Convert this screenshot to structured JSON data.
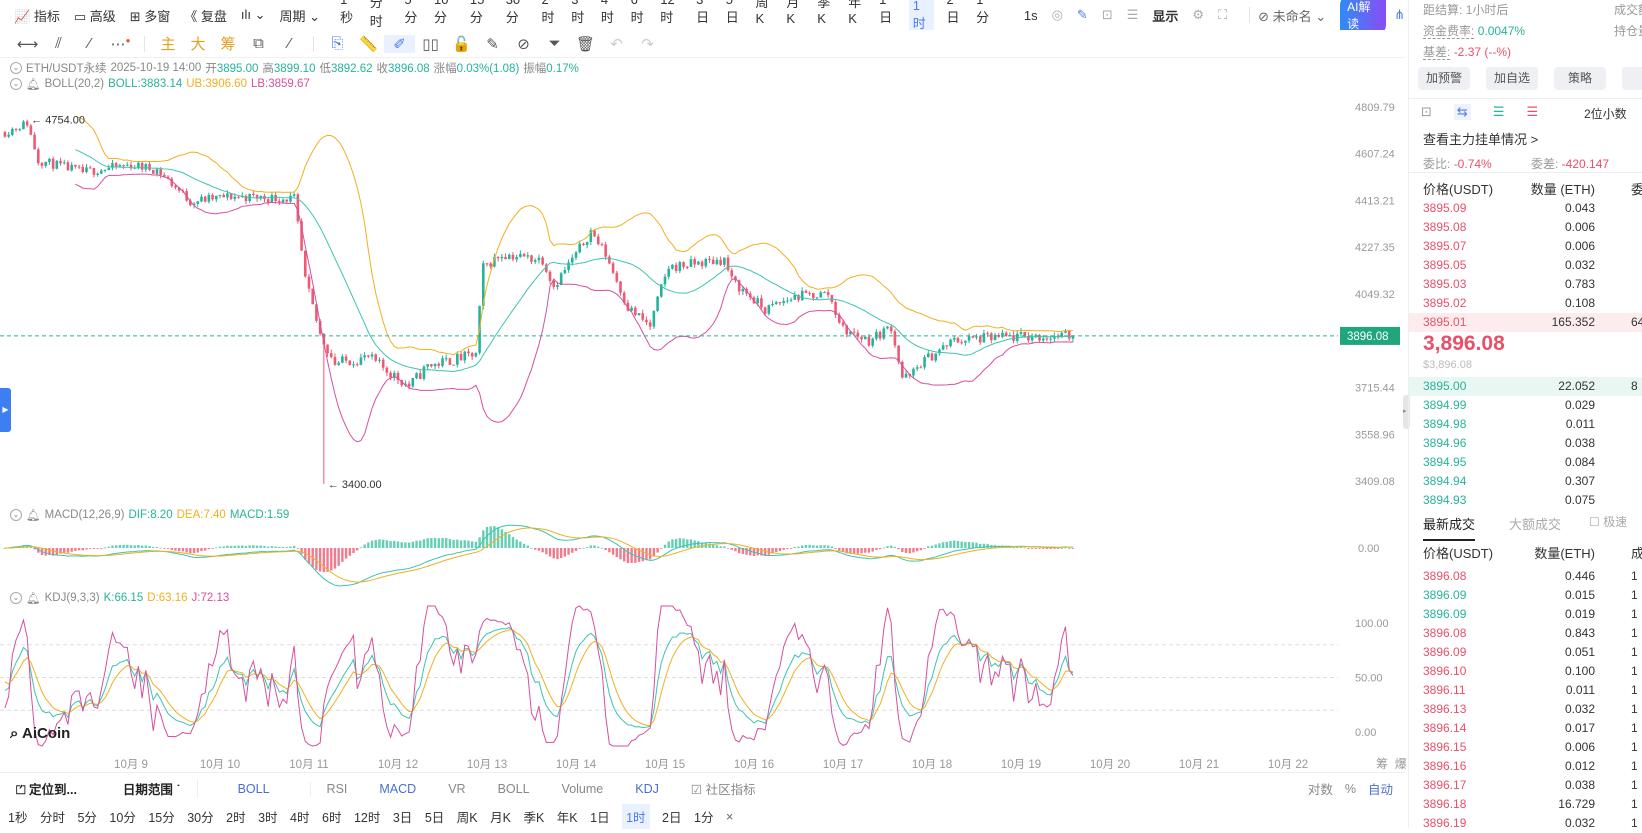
{
  "toolbar": {
    "items": [
      "指标",
      "高级",
      "多窗",
      "复盘",
      "周期"
    ],
    "periods": [
      "1秒",
      "分时",
      "5分",
      "10分",
      "15分",
      "30分",
      "2时",
      "3时",
      "4时",
      "6时",
      "12时",
      "3日",
      "5日",
      "周K",
      "月K",
      "季K",
      "年K",
      "1日",
      "1时",
      "2日",
      "1分"
    ],
    "active_period": "1时",
    "realtime": "1s",
    "display": "显示",
    "layout_name": "未命名",
    "ai_button": "AI解读"
  },
  "drawing_tools": {
    "labels": [
      "主",
      "大",
      "筹"
    ]
  },
  "legend": {
    "symbol": "ETH/USDT永续",
    "time": "2025-10-19 14:00",
    "open_label": "开",
    "open": "3895.00",
    "high_label": "高",
    "high": "3899.10",
    "low_label": "低",
    "low": "3892.62",
    "close_label": "收",
    "close": "3896.08",
    "change_label": "涨幅",
    "change": "0.03%(1.08)",
    "amp_label": "振幅",
    "amp": "0.17%"
  },
  "boll": {
    "name": "BOLL(20,2)",
    "mid": "BOLL:3883.14",
    "ub": "UB:3906.60",
    "lb": "LB:3859.67"
  },
  "macd": {
    "name": "MACD(12,26,9)",
    "dif": "DIF:8.20",
    "dea": "DEA:7.40",
    "macd": "MACD:1.59",
    "zero": "0.00"
  },
  "kdj": {
    "name": "KDJ(9,3,3)",
    "k": "K:66.15",
    "d": "D:63.16",
    "j": "J:72.13",
    "ticks": [
      "100.00",
      "50.00",
      "0.00"
    ]
  },
  "chart_data": {
    "type": "candlestick",
    "interval": "1时",
    "y_scale": "log",
    "colors": {
      "up": "#26b39b",
      "down": "#ee5a72",
      "boll_mid": "#3cc4b0",
      "boll_ub": "#f0b020",
      "boll_lb": "#d64fa0"
    },
    "y_ticks": [
      "4809.79",
      "4607.24",
      "4413.21",
      "4227.35",
      "4049.32",
      "3715.44",
      "3558.96",
      "3409.08"
    ],
    "x_ticks": [
      "10月 9",
      "10月 10",
      "10月 11",
      "10月 12",
      "10月 13",
      "10月 14",
      "10月 15",
      "10月 16",
      "10月 17",
      "10月 18",
      "10月 19",
      "10月 20",
      "10月 21",
      "10月 22"
    ],
    "last_price": "3896.08",
    "annotations": {
      "high": "4754.00",
      "low": "3400.00"
    },
    "extremes": [
      {
        "time": "2025-10-07 20:00",
        "high": 4754
      },
      {
        "time": "2025-10-11 04:00",
        "low": 3400
      }
    ],
    "close_path": [
      [
        "2025-10-07 14:00",
        4700
      ],
      [
        "2025-10-07 20:00",
        4740
      ],
      [
        "2025-10-07 23:00",
        4580
      ],
      [
        "2025-10-08 11:00",
        4530
      ],
      [
        "2025-10-09 00:00",
        4560
      ],
      [
        "2025-10-09 07:00",
        4540
      ],
      [
        "2025-10-09 16:00",
        4410
      ],
      [
        "2025-10-10 03:00",
        4430
      ],
      [
        "2025-10-10 20:00",
        4420
      ],
      [
        "2025-10-10 23:00",
        4100
      ],
      [
        "2025-10-11 03:00",
        3900
      ],
      [
        "2025-10-11 07:00",
        3800
      ],
      [
        "2025-10-11 16:00",
        3820
      ],
      [
        "2025-10-12 03:00",
        3720
      ],
      [
        "2025-10-12 08:00",
        3790
      ],
      [
        "2025-10-12 21:00",
        3830
      ],
      [
        "2025-10-12 23:00",
        4150
      ],
      [
        "2025-10-13 04:00",
        4200
      ],
      [
        "2025-10-13 15:00",
        4180
      ],
      [
        "2025-10-13 18:00",
        4080
      ],
      [
        "2025-10-14 00:00",
        4200
      ],
      [
        "2025-10-14 04:00",
        4290
      ],
      [
        "2025-10-14 08:00",
        4200
      ],
      [
        "2025-10-14 14:00",
        4000
      ],
      [
        "2025-10-14 20:00",
        3930
      ],
      [
        "2025-10-14 23:00",
        4070
      ],
      [
        "2025-10-15 01:00",
        4150
      ],
      [
        "2025-10-15 16:00",
        4180
      ],
      [
        "2025-10-15 18:00",
        4100
      ],
      [
        "2025-10-16 03:00",
        3990
      ],
      [
        "2025-10-16 11:00",
        4040
      ],
      [
        "2025-10-16 20:00",
        4050
      ],
      [
        "2025-10-17 00:00",
        3920
      ],
      [
        "2025-10-17 07:00",
        3880
      ],
      [
        "2025-10-17 13:00",
        3930
      ],
      [
        "2025-10-17 16:00",
        3750
      ],
      [
        "2025-10-17 18:00",
        3750
      ],
      [
        "2025-10-17 21:00",
        3800
      ],
      [
        "2025-10-18 06:00",
        3880
      ],
      [
        "2025-10-18 17:00",
        3890
      ],
      [
        "2025-10-19 14:00",
        3896.08
      ]
    ]
  },
  "right_axis_extra": {
    "chou": "筹",
    "bao": "爆"
  },
  "logo": "AiCoin",
  "side": {
    "settle_label": "距结算:",
    "settle": "1小时后",
    "volume_label": "成交额",
    "funding_label": "资金费率:",
    "funding": "0.0047%",
    "oi_label": "持仓量",
    "basis_label": "基差:",
    "basis": "-2.37 (--%)",
    "buttons": [
      "加预警",
      "加自选",
      "策略"
    ],
    "decimals": "2位小数",
    "main_orders": "查看主力挂单情况 >",
    "ratio_label": "委比:",
    "ratio": "-0.74%",
    "diff_label": "委差:",
    "diff": "-420.147",
    "book_header": [
      "价格(USDT)",
      "数量 (ETH)",
      "委"
    ],
    "asks": [
      [
        "3895.09",
        "0.043",
        ""
      ],
      [
        "3895.08",
        "0.006",
        ""
      ],
      [
        "3895.07",
        "0.006",
        ""
      ],
      [
        "3895.05",
        "0.032",
        ""
      ],
      [
        "3895.03",
        "0.783",
        ""
      ],
      [
        "3895.02",
        "0.108",
        ""
      ],
      [
        "3895.01",
        "165.352",
        "64"
      ]
    ],
    "mid": "3,896.08",
    "mid_usd": "$3,896.08",
    "bids": [
      [
        "3895.00",
        "22.052",
        "8"
      ],
      [
        "3894.99",
        "0.029",
        ""
      ],
      [
        "3894.98",
        "0.011",
        ""
      ],
      [
        "3894.96",
        "0.038",
        ""
      ],
      [
        "3894.95",
        "0.084",
        ""
      ],
      [
        "3894.94",
        "0.307",
        ""
      ],
      [
        "3894.93",
        "0.075",
        ""
      ]
    ],
    "tabs": [
      "最新成交",
      "大额成交"
    ],
    "fast": "极速",
    "trade_header": [
      "价格(USDT)",
      "数量(ETH)",
      "成"
    ],
    "trades": [
      [
        "3896.08",
        "0.446",
        "s"
      ],
      [
        "3896.09",
        "0.015",
        "b"
      ],
      [
        "3896.09",
        "0.019",
        "b"
      ],
      [
        "3896.08",
        "0.843",
        "s"
      ],
      [
        "3896.09",
        "0.051",
        "s"
      ],
      [
        "3896.10",
        "0.100",
        "s"
      ],
      [
        "3896.11",
        "0.011",
        "s"
      ],
      [
        "3896.13",
        "0.032",
        "s"
      ],
      [
        "3896.14",
        "0.017",
        "s"
      ],
      [
        "3896.15",
        "0.006",
        "s"
      ],
      [
        "3896.16",
        "0.012",
        "s"
      ],
      [
        "3896.17",
        "0.038",
        "s"
      ],
      [
        "3896.18",
        "16.729",
        "s"
      ],
      [
        "3896.19",
        "0.032",
        "s"
      ]
    ],
    "trade_col3": "1"
  },
  "bottom": {
    "locate": "定位到...",
    "date_range": "日期范围",
    "indicators": [
      "BOLL",
      "RSI",
      "MACD",
      "VR",
      "BOLL",
      "Volume",
      "KDJ"
    ],
    "community": "社区指标",
    "log": "对数",
    "pct": "%",
    "auto": "自动",
    "close": "×"
  }
}
